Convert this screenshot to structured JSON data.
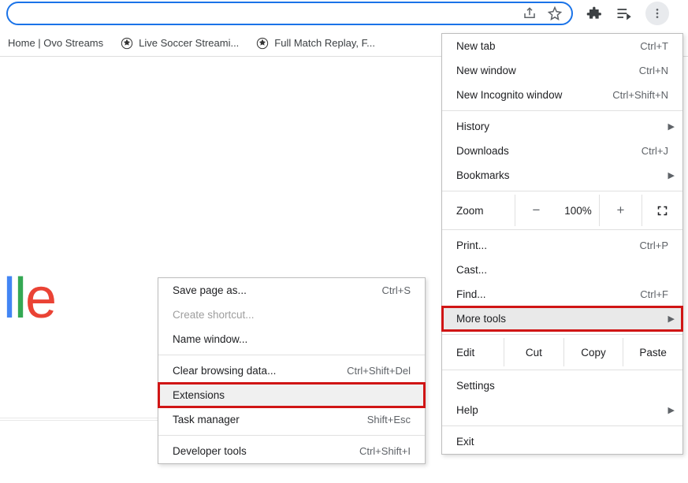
{
  "omnibox": {
    "share_icon": "share",
    "star_icon": "star"
  },
  "toolbar": {
    "ext_icon": "extensions",
    "media_icon": "media",
    "more_icon": "more"
  },
  "bookmarks": [
    {
      "icon": "none",
      "label": "Home | Ovo Streams"
    },
    {
      "icon": "soccer",
      "label": "Live Soccer Streami..."
    },
    {
      "icon": "soccer",
      "label": "Full Match Replay, F..."
    }
  ],
  "logo": {
    "c4": "l",
    "c5": "e"
  },
  "menu": {
    "new_tab": "New tab",
    "new_tab_sc": "Ctrl+T",
    "new_window": "New window",
    "new_window_sc": "Ctrl+N",
    "incognito": "New Incognito window",
    "incognito_sc": "Ctrl+Shift+N",
    "history": "History",
    "downloads": "Downloads",
    "downloads_sc": "Ctrl+J",
    "bookmarks": "Bookmarks",
    "zoom": "Zoom",
    "zoom_pct": "100%",
    "zoom_minus": "−",
    "zoom_plus": "+",
    "print": "Print...",
    "print_sc": "Ctrl+P",
    "cast": "Cast...",
    "find": "Find...",
    "find_sc": "Ctrl+F",
    "more_tools": "More tools",
    "edit": "Edit",
    "cut": "Cut",
    "copy": "Copy",
    "paste": "Paste",
    "settings": "Settings",
    "help": "Help",
    "exit": "Exit"
  },
  "submenu": {
    "save_page": "Save page as...",
    "save_page_sc": "Ctrl+S",
    "create_shortcut": "Create shortcut...",
    "name_window": "Name window...",
    "clear_data": "Clear browsing data...",
    "clear_data_sc": "Ctrl+Shift+Del",
    "extensions": "Extensions",
    "task_mgr": "Task manager",
    "task_mgr_sc": "Shift+Esc",
    "dev_tools": "Developer tools",
    "dev_tools_sc": "Ctrl+Shift+I"
  }
}
